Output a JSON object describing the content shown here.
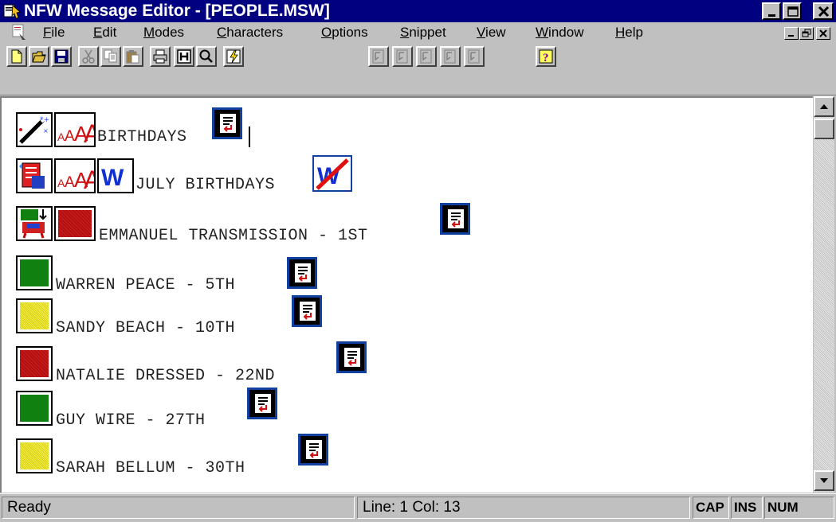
{
  "window": {
    "title": "NFW Message Editor - [PEOPLE.MSW]"
  },
  "menu": {
    "items": [
      {
        "label": "File",
        "underline": "F",
        "rest": "ile"
      },
      {
        "label": "Edit",
        "underline": "E",
        "rest": "dit"
      },
      {
        "label": "Modes",
        "underline": "M",
        "rest": "odes"
      },
      {
        "label": "Characters",
        "underline": "C",
        "rest": "haracters"
      },
      {
        "label": "Options",
        "underline": "O",
        "rest": "ptions"
      },
      {
        "label": "Snippet",
        "underline": "S",
        "rest": "nippet"
      },
      {
        "label": "View",
        "underline": "V",
        "rest": "iew"
      },
      {
        "label": "Window",
        "underline": "W",
        "rest": "indow"
      },
      {
        "label": "Help",
        "underline": "H",
        "rest": "elp"
      }
    ]
  },
  "toolbar": {
    "buttons": [
      "new-icon",
      "open-icon",
      "save-icon",
      "cut-icon",
      "copy-icon",
      "paste-icon",
      "print-icon",
      "hold-icon",
      "zoom-icon",
      "lightning-icon",
      "snippet-1-icon",
      "snippet-2-icon",
      "snippet-3-icon",
      "snippet-4-icon",
      "snippet-5-icon",
      "help-icon"
    ]
  },
  "document": {
    "lines": [
      {
        "text": "BIRTHDAYS",
        "swatch": null
      },
      {
        "text": "JULY BIRTHDAYS",
        "swatch": null
      },
      {
        "text": "EMMANUEL TRANSMISSION - 1ST",
        "swatch": "red"
      },
      {
        "text": "WARREN PEACE - 5TH",
        "swatch": "green"
      },
      {
        "text": "SANDY BEACH - 10TH",
        "swatch": "yellow"
      },
      {
        "text": "NATALIE DRESSED - 22ND",
        "swatch": "red"
      },
      {
        "text": "GUY WIRE - 27TH",
        "swatch": "green"
      },
      {
        "text": "SARAH BELLUM - 30TH",
        "swatch": "yellow"
      }
    ]
  },
  "status": {
    "message": "Ready",
    "position": "Line: 1  Col: 13",
    "cap": "CAP",
    "ins": "INS",
    "num": "NUM"
  },
  "colors": {
    "titlebar": "#000080",
    "chrome": "#c0c0c0",
    "swatch_green": "#108010",
    "swatch_red": "#c01818",
    "swatch_yellow": "#e8e030"
  }
}
